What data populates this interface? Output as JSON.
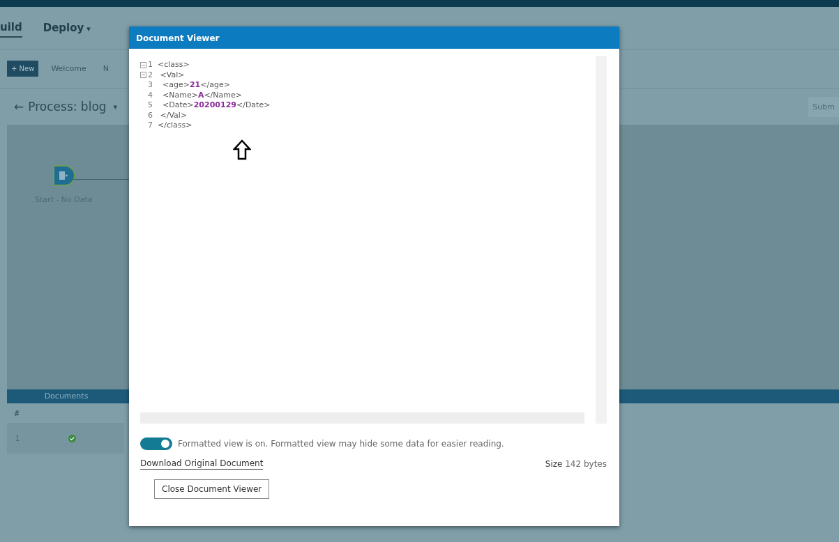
{
  "nav": {
    "items": [
      {
        "label": "uild",
        "selected": true
      },
      {
        "label": "Deploy",
        "selected": false,
        "caret": "▾"
      }
    ]
  },
  "tabs_bar": {
    "new_button": "+ New",
    "tabs": [
      {
        "label": "Welcome",
        "selected": false
      },
      {
        "label": "N",
        "selected": false
      }
    ]
  },
  "process": {
    "back_icon": "←",
    "title": "Process: blog",
    "caret": "▾",
    "submit_button": "Subm"
  },
  "canvas": {
    "nodes": [
      {
        "label": "Start - No Data"
      }
    ]
  },
  "documents_panel": {
    "title": "Documents",
    "columns": [
      "#"
    ],
    "rows": [
      {
        "number": "1",
        "status_ok": true
      }
    ]
  },
  "dialog": {
    "title": "Document Viewer",
    "code_lines": [
      {
        "number": "1",
        "foldable": true,
        "parts": [
          {
            "kind": "tag",
            "text": "<class>"
          }
        ]
      },
      {
        "number": "2",
        "foldable": true,
        "parts": [
          {
            "kind": "tag",
            "text": " <Val>"
          }
        ]
      },
      {
        "number": "3",
        "foldable": false,
        "parts": [
          {
            "kind": "tag",
            "text": "  <age>"
          },
          {
            "kind": "value",
            "text": "21"
          },
          {
            "kind": "tag",
            "text": "</age>"
          }
        ]
      },
      {
        "number": "4",
        "foldable": false,
        "parts": [
          {
            "kind": "tag",
            "text": "  <Name>"
          },
          {
            "kind": "value",
            "text": "A"
          },
          {
            "kind": "tag",
            "text": "</Name>"
          }
        ]
      },
      {
        "number": "5",
        "foldable": false,
        "parts": [
          {
            "kind": "tag",
            "text": "  <Date>"
          },
          {
            "kind": "value",
            "text": "20200129"
          },
          {
            "kind": "tag",
            "text": "</Date>"
          }
        ]
      },
      {
        "number": "6",
        "foldable": false,
        "parts": [
          {
            "kind": "tag",
            "text": " </Val>"
          }
        ]
      },
      {
        "number": "7",
        "foldable": false,
        "parts": [
          {
            "kind": "tag",
            "text": "</class>"
          }
        ]
      }
    ],
    "formatted_toggle": {
      "on": true,
      "label": "Formatted view is on. Formatted view may hide some data for easier reading."
    },
    "download_link": "Download Original Document",
    "size_label": "Size",
    "size_value": "142 bytes",
    "close_button": "Close Document Viewer"
  }
}
